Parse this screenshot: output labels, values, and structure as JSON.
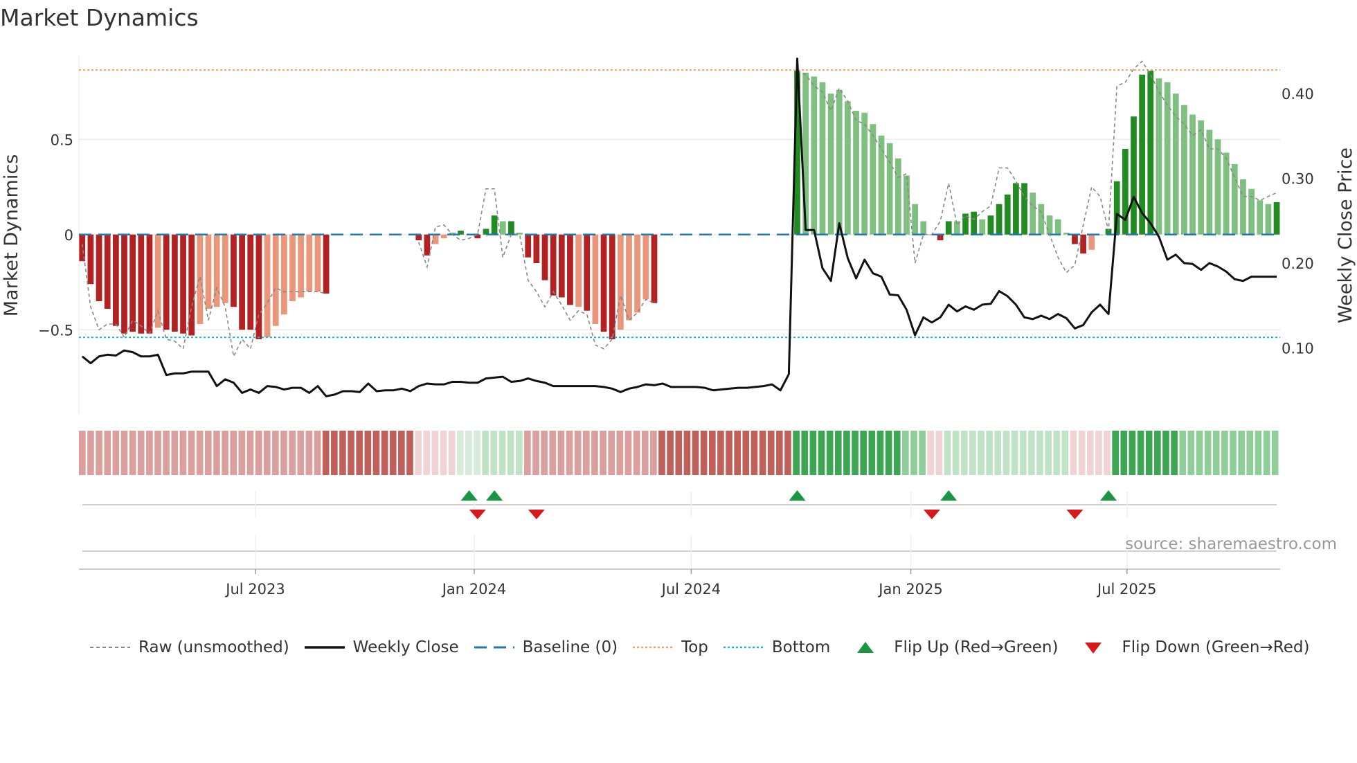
{
  "title": "Market Dynamics",
  "source": "source: sharemaestro.com",
  "legend": [
    {
      "label": "Raw (unsmoothed)",
      "icon": "dashed-gray-line"
    },
    {
      "label": "Weekly Close",
      "icon": "solid-black-line"
    },
    {
      "label": "Baseline (0)",
      "icon": "dashed-blue-line"
    },
    {
      "label": "Top",
      "icon": "dotted-orange-line"
    },
    {
      "label": "Bottom",
      "icon": "dotted-cyan-line"
    },
    {
      "label": "Flip Up (Red→Green)",
      "icon": "triangle-up"
    },
    {
      "label": "Flip Down (Green→Red)",
      "icon": "triangle-down"
    }
  ],
  "colors": {
    "strong_red": "#b22222",
    "light_red": "#e9967a",
    "strong_green": "#228b22",
    "light_green": "#7fbf7f",
    "close": "#111111",
    "raw": "#888888",
    "baseline": "#1f77b4",
    "top": "#f4a460",
    "bottom": "#17becf",
    "flip_up": "#1a9641",
    "flip_down": "#d7191c",
    "strip": {
      "-2": "#c0605a",
      "-1": "#dba09e",
      "-0.5": "#f0d4d4",
      "0.5": "#d6ecd8",
      "1": "#bfe3c4",
      "1.5": "#8fce99",
      "2": "#3da653"
    }
  },
  "chart_data": {
    "type": "bar",
    "ylabel": "Market Dynamics",
    "ylabel_right": "Weekly Close Price",
    "ylim": [
      -1.0,
      0.94
    ],
    "ylim_right": [
      0.0,
      0.46
    ],
    "yticks": [
      {
        "v": 0.5,
        "label": "0.5"
      },
      {
        "v": 0,
        "label": "0"
      },
      {
        "v": -0.5,
        "label": "−0.5"
      }
    ],
    "yticks_right": [
      {
        "v": 0.4,
        "label": "0.40"
      },
      {
        "v": 0.3,
        "label": "0.30"
      },
      {
        "v": 0.2,
        "label": "0.20"
      },
      {
        "v": 0.1,
        "label": "0.10"
      }
    ],
    "xticks": [
      {
        "week": 20.6,
        "label": "Jul 2023"
      },
      {
        "week": 46.6,
        "label": "Jan 2024"
      },
      {
        "week": 72.4,
        "label": "Jul 2024"
      },
      {
        "week": 98.5,
        "label": "Jan 2025"
      },
      {
        "week": 124.2,
        "label": "Jul 2025"
      }
    ],
    "weeks": 143,
    "top": 0.864,
    "bottom": -0.54,
    "baseline": 0,
    "bars": [
      {
        "start": 0,
        "values": [
          -0.14,
          -0.26,
          -0.35,
          -0.39,
          -0.48,
          -0.52,
          -0.51,
          -0.52,
          -0.52,
          -0.49,
          -0.5,
          -0.51,
          -0.52,
          -0.53,
          -0.47,
          -0.39,
          -0.38,
          -0.36,
          -0.38,
          -0.5,
          -0.5,
          -0.55,
          -0.54,
          -0.48,
          -0.42,
          -0.35,
          -0.33,
          -0.3,
          -0.3,
          -0.31
        ],
        "strong": [
          1,
          1,
          1,
          1,
          1,
          1,
          1,
          1,
          1,
          0,
          1,
          1,
          1,
          1,
          0,
          0,
          0,
          0,
          1,
          1,
          1,
          1,
          0,
          0,
          0,
          0,
          0,
          0,
          0,
          1
        ]
      },
      {
        "start": 40,
        "values": [
          -0.03,
          -0.11,
          -0.05,
          -0.02,
          0.01,
          0.02,
          null,
          -0.02,
          0.03,
          0.1,
          0.07,
          0.07,
          0.01,
          -0.12,
          -0.15,
          -0.24,
          -0.32,
          -0.33,
          -0.37,
          -0.38,
          -0.4,
          -0.47,
          -0.51,
          -0.55,
          -0.5,
          -0.45,
          -0.41,
          -0.34,
          -0.36
        ],
        "strong": [
          1,
          1,
          0,
          0,
          0,
          1,
          0,
          1,
          1,
          1,
          0,
          1,
          0,
          1,
          1,
          1,
          1,
          1,
          1,
          0,
          1,
          0,
          1,
          1,
          0,
          0,
          0,
          0,
          1
        ]
      },
      {
        "start": 85,
        "values": [
          0.86,
          0.85,
          0.83,
          0.8,
          0.74,
          0.76,
          0.7,
          0.65,
          0.64,
          0.58,
          0.52,
          0.48,
          0.4,
          0.31,
          0.16,
          0.07,
          0.0,
          -0.03,
          0.07,
          0.07,
          0.11,
          0.12,
          0.08,
          0.1,
          0.16,
          0.21,
          0.27,
          0.27,
          0.22,
          0.16,
          0.1,
          0.08,
          0.01,
          -0.05,
          -0.1,
          -0.08,
          0.0,
          0.03,
          0.28,
          0.45,
          0.62,
          0.84,
          0.86,
          0.82,
          0.8,
          0.74,
          0.68,
          0.63,
          0.6,
          0.55,
          0.5,
          0.43,
          0.37,
          0.29,
          0.24,
          0.18,
          0.16,
          0.17
        ],
        "strong": [
          1,
          0,
          0,
          0,
          0,
          0,
          0,
          0,
          0,
          0,
          0,
          0,
          0,
          0,
          0,
          0,
          0,
          1,
          1,
          0,
          1,
          1,
          0,
          1,
          1,
          1,
          1,
          1,
          0,
          0,
          0,
          0,
          0,
          1,
          1,
          0,
          0,
          1,
          1,
          1,
          1,
          1,
          1,
          0,
          0,
          0,
          0,
          0,
          0,
          0,
          0,
          0,
          0,
          0,
          0,
          0,
          0,
          1
        ]
      }
    ],
    "raw": [
      {
        "start": 0,
        "values": [
          -0.05,
          -0.38,
          -0.5,
          -0.47,
          -0.47,
          -0.54,
          -0.45,
          -0.48,
          -0.52,
          -0.4,
          -0.55,
          -0.56,
          -0.6,
          -0.38,
          -0.22,
          -0.45,
          -0.28,
          -0.38,
          -0.64,
          -0.55,
          -0.6,
          -0.42,
          -0.36,
          -0.28,
          -0.3,
          -0.3,
          -0.3,
          -0.3,
          -0.3,
          -0.31
        ]
      },
      {
        "start": 40,
        "values": [
          -0.04,
          -0.17,
          0.04,
          0.05,
          0.0,
          -0.03,
          -0.02,
          0.0,
          0.24,
          0.24,
          -0.12,
          0.0,
          0.0,
          -0.24,
          -0.3,
          -0.38,
          -0.3,
          -0.37,
          -0.45,
          -0.4,
          -0.42,
          -0.58,
          -0.6,
          -0.55,
          -0.32,
          -0.45,
          -0.41,
          -0.34,
          -0.36
        ]
      },
      {
        "start": 85,
        "values": [
          0.86,
          0.84,
          0.78,
          0.75,
          0.65,
          0.77,
          0.7,
          0.6,
          0.58,
          0.52,
          0.45,
          0.38,
          0.3,
          0.32,
          -0.15,
          0.0,
          0.0,
          0.07,
          0.27,
          0.05,
          0.1,
          0.08,
          0.12,
          0.15,
          0.35,
          0.35,
          0.28,
          0.2,
          0.15,
          0.12,
          0.0,
          -0.12,
          -0.2,
          -0.16,
          0.05,
          0.25,
          0.2,
          0.02,
          0.78,
          0.8,
          0.87,
          0.91,
          0.84,
          0.75,
          0.68,
          0.62,
          0.58,
          0.52,
          0.55,
          0.45,
          0.45,
          0.4,
          0.3,
          0.2,
          0.2,
          0.18,
          0.2,
          0.22
        ]
      }
    ],
    "close": [
      0.09,
      0.082,
      0.09,
      0.092,
      0.091,
      0.097,
      0.095,
      0.09,
      0.09,
      0.092,
      0.068,
      0.07,
      0.07,
      0.072,
      0.072,
      0.072,
      0.055,
      0.063,
      0.059,
      0.047,
      0.051,
      0.047,
      0.055,
      0.054,
      0.051,
      0.053,
      0.053,
      0.047,
      0.055,
      0.043,
      0.045,
      0.049,
      0.049,
      0.048,
      0.058,
      0.049,
      0.05,
      0.05,
      0.052,
      0.049,
      0.055,
      0.058,
      0.057,
      0.057,
      0.06,
      0.06,
      0.059,
      0.059,
      0.064,
      0.065,
      0.066,
      0.06,
      0.061,
      0.064,
      0.061,
      0.059,
      0.055,
      0.055,
      0.055,
      0.055,
      0.055,
      0.055,
      0.054,
      0.052,
      0.048,
      0.052,
      0.054,
      0.057,
      0.056,
      0.058,
      0.054,
      0.054,
      0.054,
      0.054,
      0.053,
      0.05,
      0.051,
      0.052,
      0.053,
      0.053,
      0.054,
      0.055,
      0.057,
      0.05,
      0.069,
      0.441,
      0.239,
      0.239,
      0.194,
      0.179,
      0.247,
      0.206,
      0.182,
      0.204,
      0.188,
      0.184,
      0.163,
      0.162,
      0.145,
      0.115,
      0.136,
      0.13,
      0.136,
      0.151,
      0.143,
      0.149,
      0.145,
      0.151,
      0.152,
      0.167,
      0.161,
      0.151,
      0.136,
      0.134,
      0.138,
      0.134,
      0.14,
      0.135,
      0.123,
      0.127,
      0.142,
      0.151,
      0.14,
      0.258,
      0.251,
      0.278,
      0.259,
      0.247,
      0.231,
      0.204,
      0.21,
      0.2,
      0.199,
      0.192,
      0.2,
      0.196,
      0.19,
      0.181,
      0.179,
      0.184,
      0.184,
      0.184,
      0.184
    ],
    "strip": [
      {
        "from": 0,
        "to": 29,
        "level": "-1"
      },
      {
        "from": 29,
        "to": 40,
        "level": "-2"
      },
      {
        "from": 40,
        "to": 45,
        "level": "-0.5"
      },
      {
        "from": 45,
        "to": 48,
        "level": "0.5"
      },
      {
        "from": 48,
        "to": 53,
        "level": "1"
      },
      {
        "from": 53,
        "to": 69,
        "level": "-1"
      },
      {
        "from": 69,
        "to": 85,
        "level": "-2"
      },
      {
        "from": 85,
        "to": 98,
        "level": "2"
      },
      {
        "from": 98,
        "to": 101,
        "level": "1.5"
      },
      {
        "from": 101,
        "to": 103,
        "level": "-0.5"
      },
      {
        "from": 103,
        "to": 118,
        "level": "1"
      },
      {
        "from": 118,
        "to": 123,
        "level": "-0.5"
      },
      {
        "from": 123,
        "to": 131,
        "level": "2"
      },
      {
        "from": 131,
        "to": 143,
        "level": "1.5"
      }
    ],
    "flip_up_weeks": [
      46,
      49,
      85,
      103,
      122
    ],
    "flip_down_weeks": [
      47,
      54,
      101,
      118
    ]
  }
}
